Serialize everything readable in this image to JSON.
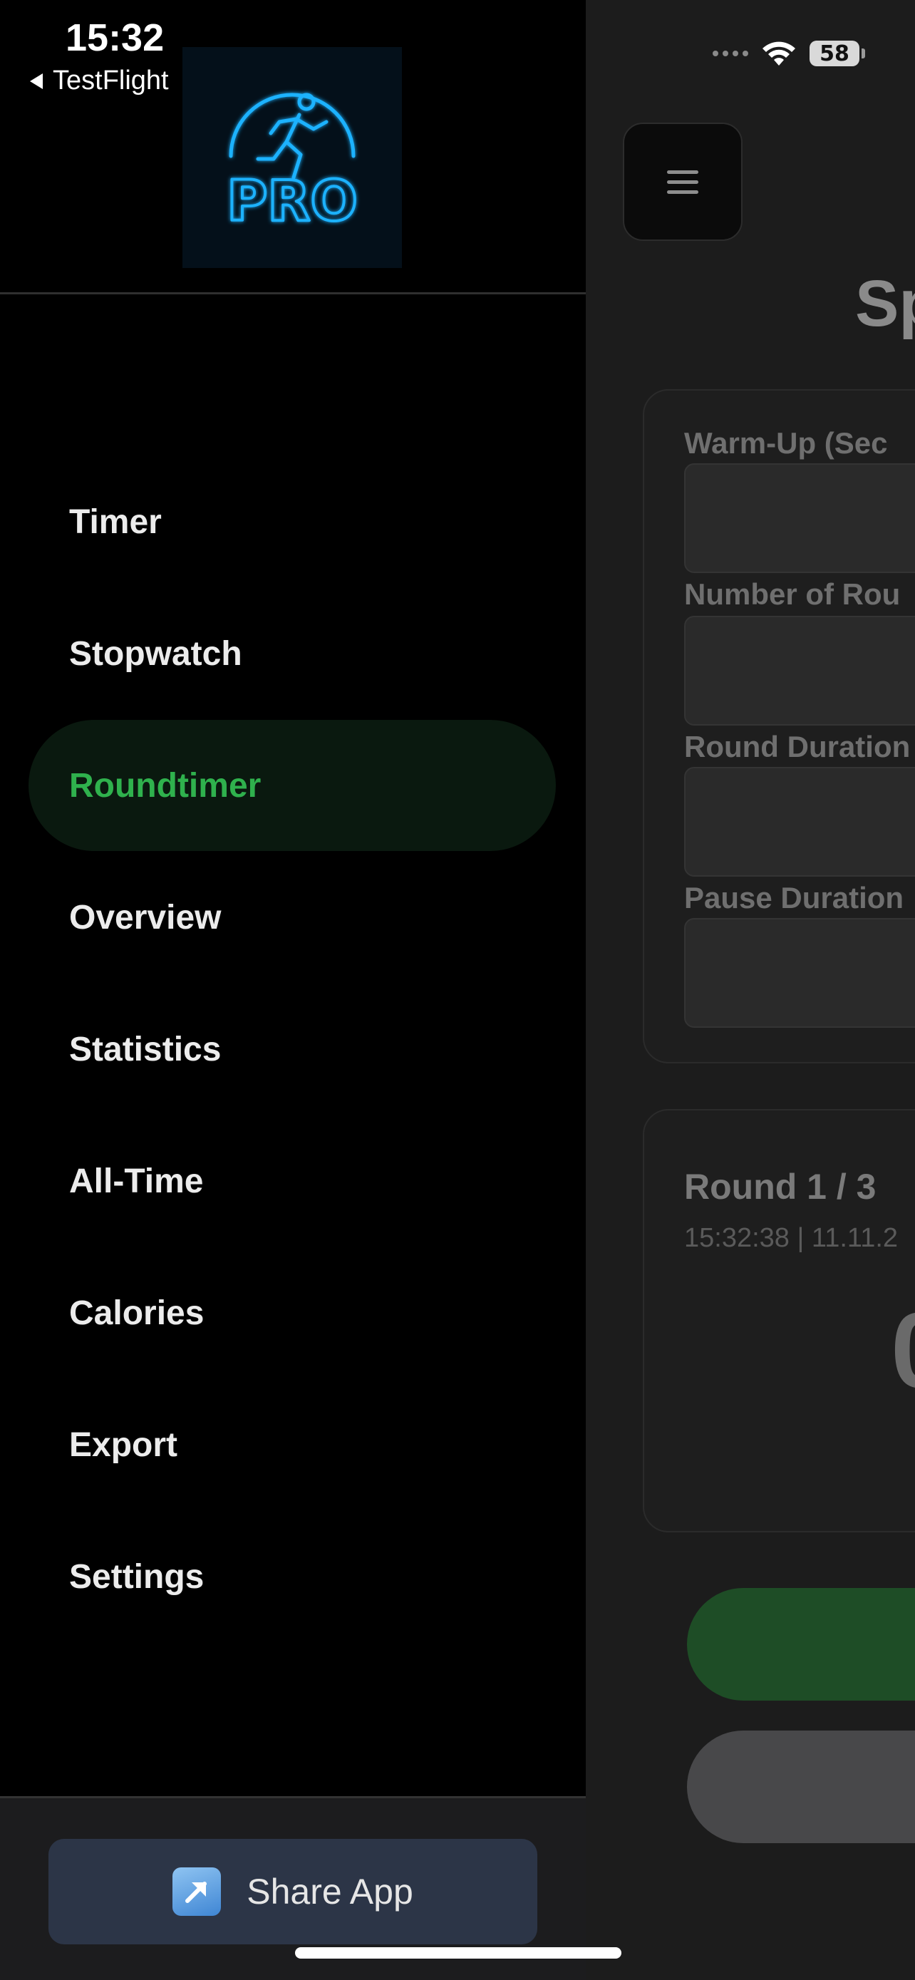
{
  "status_bar": {
    "time": "15:32",
    "back_app": "TestFlight",
    "battery": "58"
  },
  "background_app": {
    "title_partial": "Sp",
    "fields": [
      {
        "label": "Warm-Up (Sec"
      },
      {
        "label": "Number of Rou"
      },
      {
        "label": "Round Duration"
      },
      {
        "label": "Pause Duration"
      }
    ],
    "round": {
      "title": "Round 1 / 3",
      "timestamp": "15:32:38 | 11.11.2",
      "big_value_partial": "0"
    }
  },
  "drawer": {
    "logo_text": "PRO",
    "nav_items": [
      {
        "label": "Timer",
        "active": false
      },
      {
        "label": "Stopwatch",
        "active": false
      },
      {
        "label": "Roundtimer",
        "active": true
      },
      {
        "label": "Overview",
        "active": false
      },
      {
        "label": "Statistics",
        "active": false
      },
      {
        "label": "All-Time",
        "active": false
      },
      {
        "label": "Calories",
        "active": false
      },
      {
        "label": "Export",
        "active": false
      },
      {
        "label": "Settings",
        "active": false
      }
    ],
    "share_button": {
      "label": "Share App",
      "icon": "share-arrow-icon"
    }
  },
  "colors": {
    "accent_green": "#2fb14d",
    "active_bg": "#0a190f",
    "logo_neon": "#1fb2ff"
  }
}
